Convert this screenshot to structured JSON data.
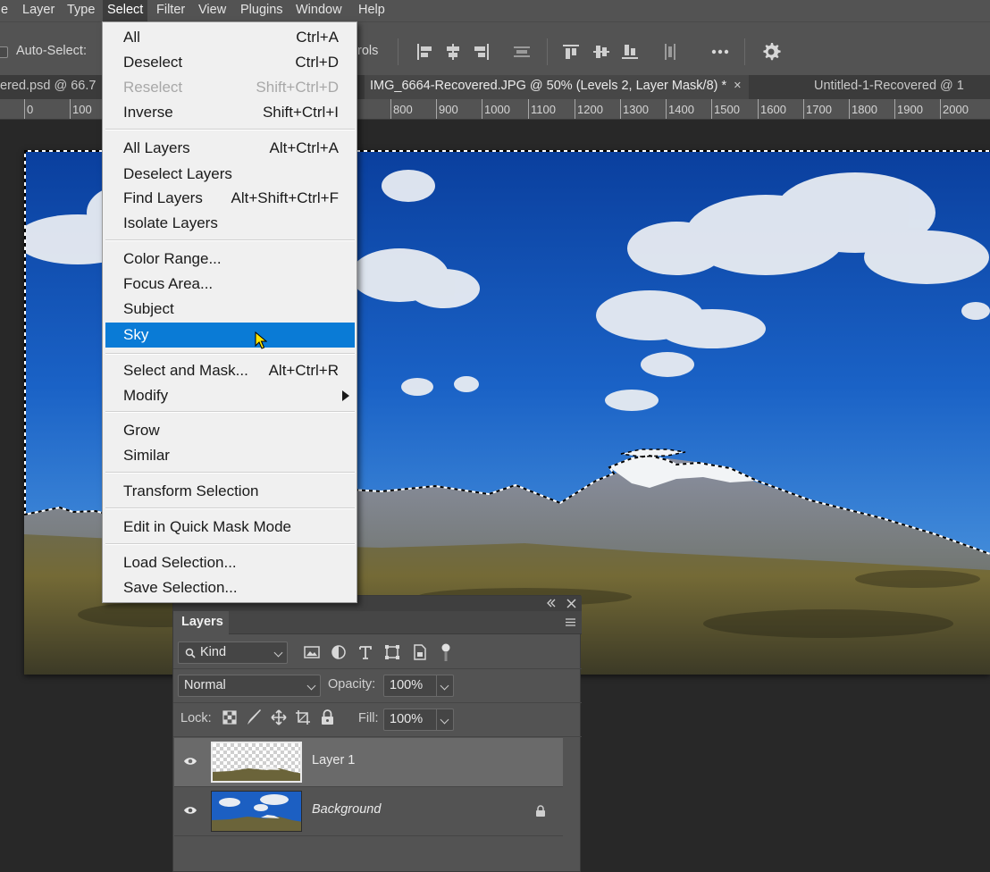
{
  "menubar": {
    "items": [
      {
        "label": "e"
      },
      {
        "label": "Layer"
      },
      {
        "label": "Type"
      },
      {
        "label": "Select"
      },
      {
        "label": "Filter"
      },
      {
        "label": "View"
      },
      {
        "label": "Plugins"
      },
      {
        "label": "Window"
      },
      {
        "label": "Help"
      }
    ],
    "active_item": "Select"
  },
  "options_bar": {
    "auto_select_label": "Auto-Select:",
    "controls_fragment": "rols"
  },
  "tabs": [
    {
      "label": "ered.psd @ 66.7"
    },
    {
      "label": "IMG_6664-Recovered.JPG @ 50% (Levels 2, Layer Mask/8) *",
      "close": "×",
      "active": true
    },
    {
      "label": "Untitled-1-Recovered @ 1"
    }
  ],
  "ruler": {
    "labels": [
      "0",
      "100",
      "800",
      "900",
      "1000",
      "1100",
      "1200",
      "1300",
      "1400",
      "1500",
      "1600",
      "1700",
      "1800",
      "1900",
      "2000"
    ]
  },
  "select_menu": {
    "items": [
      {
        "label": "All",
        "shortcut": "Ctrl+A"
      },
      {
        "label": "Deselect",
        "shortcut": "Ctrl+D"
      },
      {
        "label": "Reselect",
        "shortcut": "Shift+Ctrl+D",
        "disabled": true
      },
      {
        "label": "Inverse",
        "shortcut": "Shift+Ctrl+I"
      },
      {
        "label": "All Layers",
        "shortcut": "Alt+Ctrl+A"
      },
      {
        "label": "Deselect Layers",
        "shortcut": ""
      },
      {
        "label": "Find Layers",
        "shortcut": "Alt+Shift+Ctrl+F"
      },
      {
        "label": "Isolate Layers",
        "shortcut": ""
      },
      {
        "label": "Color Range...",
        "shortcut": ""
      },
      {
        "label": "Focus Area...",
        "shortcut": ""
      },
      {
        "label": "Subject",
        "shortcut": ""
      },
      {
        "label": "Sky",
        "shortcut": "",
        "highlighted": true
      },
      {
        "label": "Select and Mask...",
        "shortcut": "Alt+Ctrl+R"
      },
      {
        "label": "Modify",
        "shortcut": "",
        "submenu": true
      },
      {
        "label": "Grow",
        "shortcut": ""
      },
      {
        "label": "Similar",
        "shortcut": ""
      },
      {
        "label": "Transform Selection",
        "shortcut": ""
      },
      {
        "label": "Edit in Quick Mask Mode",
        "shortcut": ""
      },
      {
        "label": "Load Selection...",
        "shortcut": ""
      },
      {
        "label": "Save Selection...",
        "shortcut": ""
      }
    ]
  },
  "layers_panel": {
    "title": "Layers",
    "filter_kind": "Kind",
    "blend_mode": "Normal",
    "opacity_label": "Opacity:",
    "opacity_value": "100%",
    "lock_label": "Lock:",
    "fill_label": "Fill:",
    "fill_value": "100%",
    "layers": [
      {
        "name": "Layer 1",
        "selected": true,
        "visible": true
      },
      {
        "name": "Background",
        "selected": false,
        "visible": true,
        "locked": true
      }
    ]
  },
  "colors": {
    "ui_dark": "#535353",
    "canvas_bg": "#282828",
    "menu_bg": "#f0f0f0",
    "highlight": "#0a7bd6",
    "sky_top": "#0a3f9e",
    "sky_mid": "#1e6ed0"
  }
}
